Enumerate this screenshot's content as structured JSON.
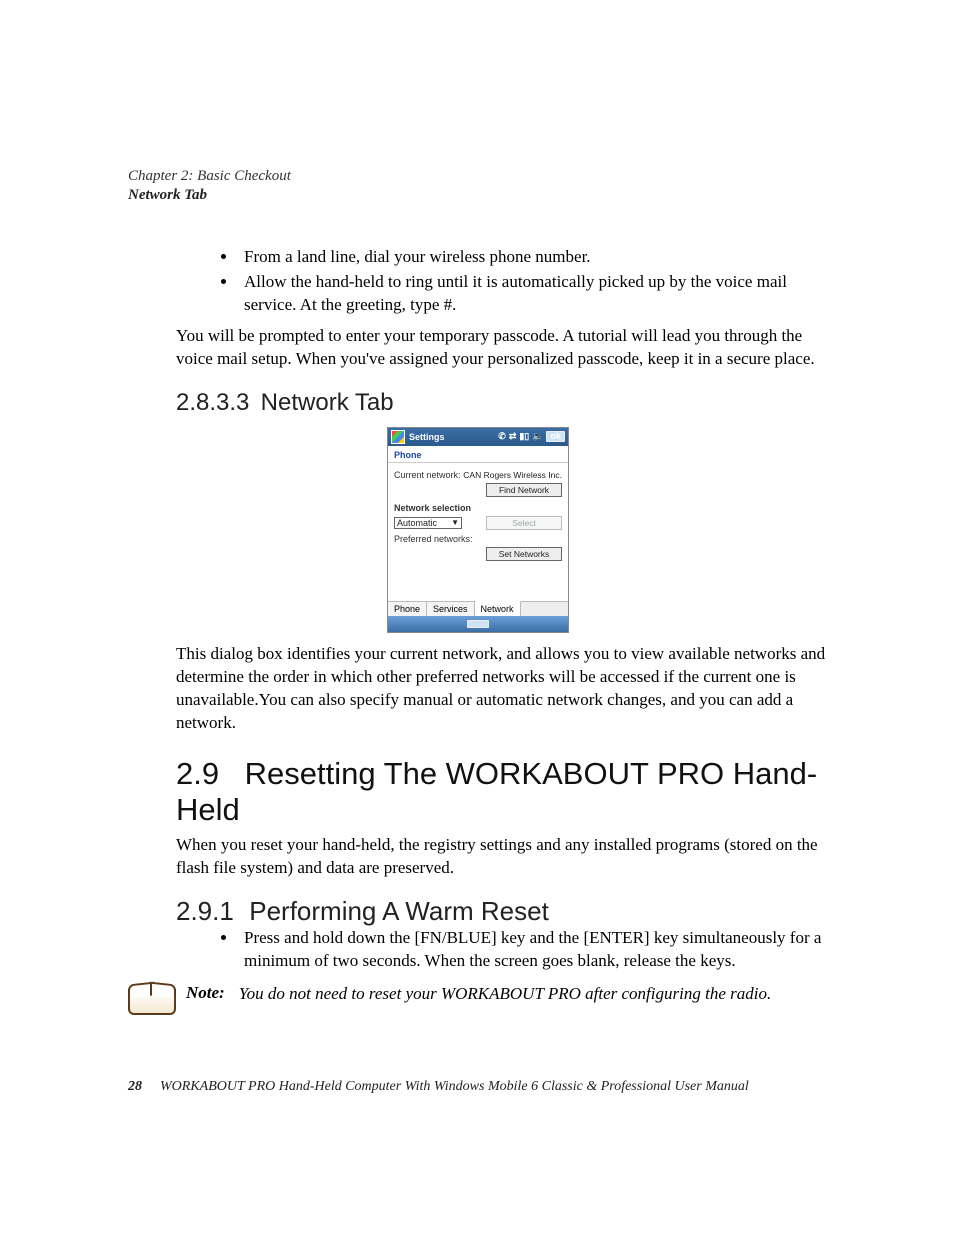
{
  "header": {
    "chapter": "Chapter  2:  Basic Checkout",
    "section": "Network Tab"
  },
  "bullets_top": [
    "From a land line, dial your wireless phone number.",
    "Allow the hand-held to ring until it is automatically picked up by the voice mail service. At the greeting, type #."
  ],
  "para_after_bullets": "You will be prompted to enter your temporary passcode. A tutorial will lead you through the voice mail setup. When you've assigned your personalized passcode, keep it in a secure place.",
  "h_2833": {
    "num": "2.8.3.3",
    "title": "Network Tab"
  },
  "screenshot": {
    "title": "Settings",
    "ok": "ok",
    "subtitle": "Phone",
    "current_label": "Current network:",
    "current_value": "CAN Rogers Wireless Inc.",
    "find_btn": "Find Network",
    "net_sel_label": "Network selection",
    "net_sel_value": "Automatic",
    "select_btn": "Select",
    "pref_label": "Preferred networks:",
    "set_btn": "Set Networks",
    "tabs": [
      "Phone",
      "Services",
      "Network"
    ]
  },
  "para_after_shot": "This dialog box identifies your current network, and allows you to view available networks and determine the order in which other preferred networks will be accessed if the current one is unavailable.You can also specify manual or automatic network changes, and you can add a network.",
  "h_29": {
    "num": "2.9",
    "title": "Resetting The WORKABOUT PRO Hand-Held"
  },
  "para_29": "When you reset your hand-held, the registry settings and any installed programs (stored on the flash file system) and data are preserved.",
  "h_291": {
    "num": "2.9.1",
    "title": "Performing A Warm Reset"
  },
  "bullets_291": [
    "Press and hold down the [FN/BLUE] key and the [ENTER] key simultaneously for a minimum of two seconds. When the screen goes blank, release the keys."
  ],
  "note": {
    "label": "Note:",
    "text": "You do not need to reset your WORKABOUT PRO after configuring the radio."
  },
  "footer": {
    "page": "28",
    "title": "WORKABOUT PRO Hand-Held Computer With Windows Mobile 6 Classic & Professional User Manual"
  }
}
